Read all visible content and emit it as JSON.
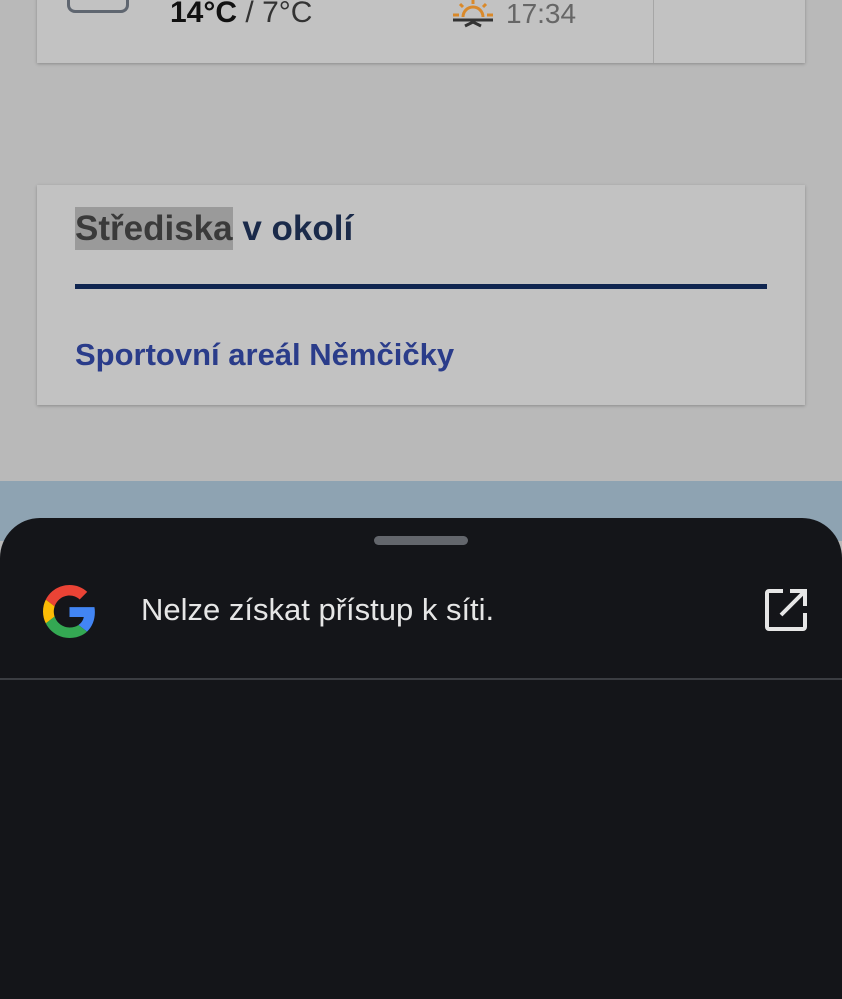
{
  "weather": {
    "temp_high": "14°C",
    "separator": "/",
    "temp_low": "7°C",
    "sunset_time": "17:34",
    "icons": {
      "weather": "cloud-icon",
      "sun": "sunset-icon"
    }
  },
  "nearby": {
    "title_highlight": "Střediska",
    "title_rest": " v okolí",
    "items": [
      {
        "label": "Sportovní areál Němčičky"
      }
    ]
  },
  "sheet": {
    "message": "Nelze získat přístup k síti.",
    "icons": {
      "logo": "google-g-icon",
      "action": "open-in-new-icon"
    }
  },
  "colors": {
    "title": "#1a2a4a",
    "rule": "#0f2550",
    "link": "#2a3c8a",
    "sheet_bg": "#141519",
    "sun": "#d9892a"
  }
}
